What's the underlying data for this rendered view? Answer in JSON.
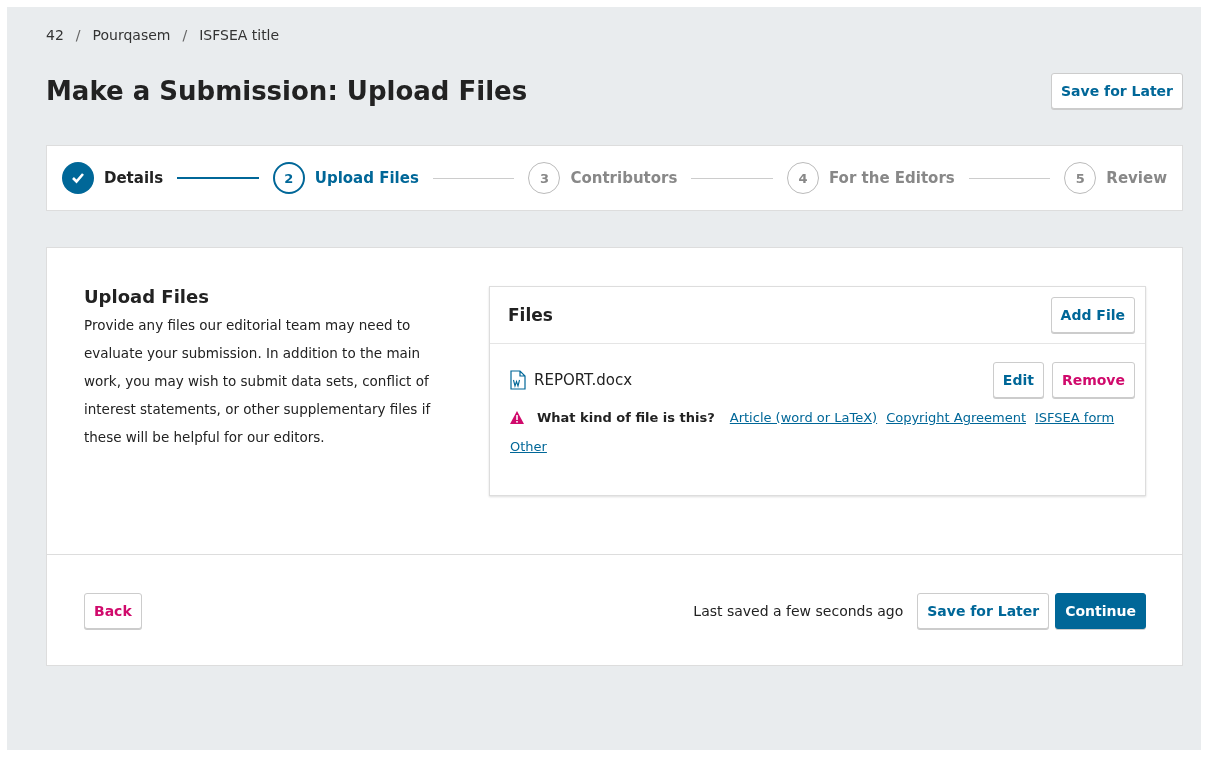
{
  "breadcrumbs": [
    {
      "kind": "item",
      "text": "42"
    },
    {
      "kind": "separator",
      "text": "/"
    },
    {
      "kind": "item",
      "text": "Pourqasem"
    },
    {
      "kind": "separator",
      "text": "/"
    },
    {
      "kind": "item",
      "text": "ISFSEA title"
    }
  ],
  "title": "Make a Submission: Upload Files",
  "header_button": "Save for Later",
  "steps": [
    {
      "label": "Details",
      "complete": true,
      "selected": false
    },
    {
      "number": "2",
      "label": "Upload Files",
      "complete": false,
      "selected": true
    },
    {
      "number": "3",
      "label": "Contributors",
      "complete": false,
      "selected": false
    },
    {
      "number": "4",
      "label": "For the Editors",
      "complete": false,
      "selected": false
    },
    {
      "number": "5",
      "label": "Review",
      "complete": false,
      "selected": false
    }
  ],
  "section": {
    "heading": "Upload Files",
    "description": "Provide any files our editorial team may need to evaluate your submission. In addition to the main work, you may wish to submit data sets, conflict of interest statements, or other supplementary files if these will be helpful for our editors."
  },
  "files_panel": {
    "title": "Files",
    "add_button": "Add File",
    "files": [
      {
        "name": "REPORT.docx",
        "edit_button": "Edit",
        "remove_button": "Remove",
        "prompt": "What kind of file is this?",
        "kinds": [
          "Article (word or LaTeX)",
          "Copyright Agreement",
          "ISFSEA form",
          "Other"
        ]
      }
    ]
  },
  "footer": {
    "back_button": "Back",
    "status": "Last saved a few seconds ago",
    "save_button": "Save for Later",
    "continue_button": "Continue"
  }
}
